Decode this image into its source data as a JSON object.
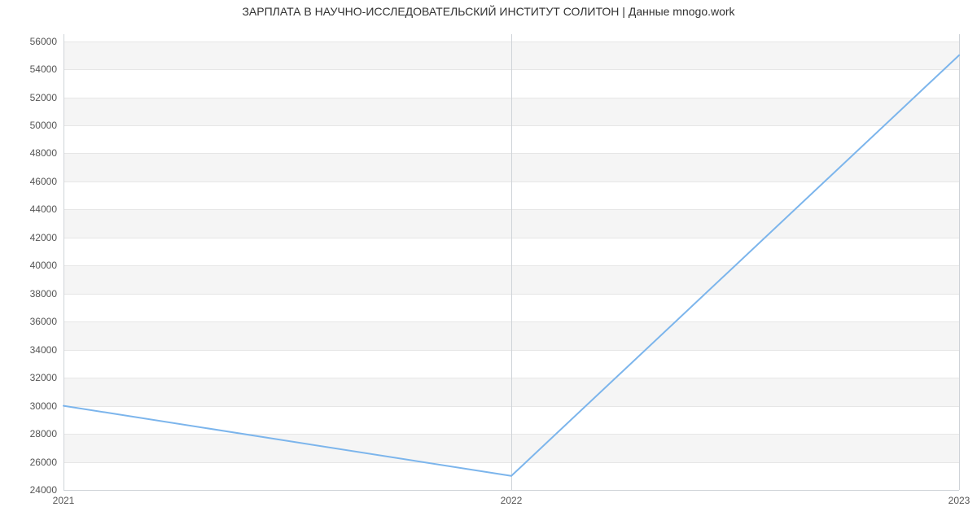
{
  "chart_data": {
    "type": "line",
    "title": "ЗАРПЛАТА В  НАУЧНО-ИССЛЕДОВАТЕЛЬСКИЙ ИНСТИТУТ СОЛИТОН | Данные mnogo.work",
    "x": [
      2021,
      2022,
      2023
    ],
    "values": [
      30000,
      25000,
      55000
    ],
    "xlabel": "",
    "ylabel": "",
    "xlim": [
      2021,
      2023
    ],
    "ylim": [
      24000,
      56500
    ],
    "xticks": [
      2021,
      2022,
      2023
    ],
    "yticks": [
      24000,
      26000,
      28000,
      30000,
      32000,
      34000,
      36000,
      38000,
      40000,
      42000,
      44000,
      46000,
      48000,
      50000,
      52000,
      54000,
      56000
    ],
    "line_color": "#7cb5ec",
    "grid": true
  }
}
